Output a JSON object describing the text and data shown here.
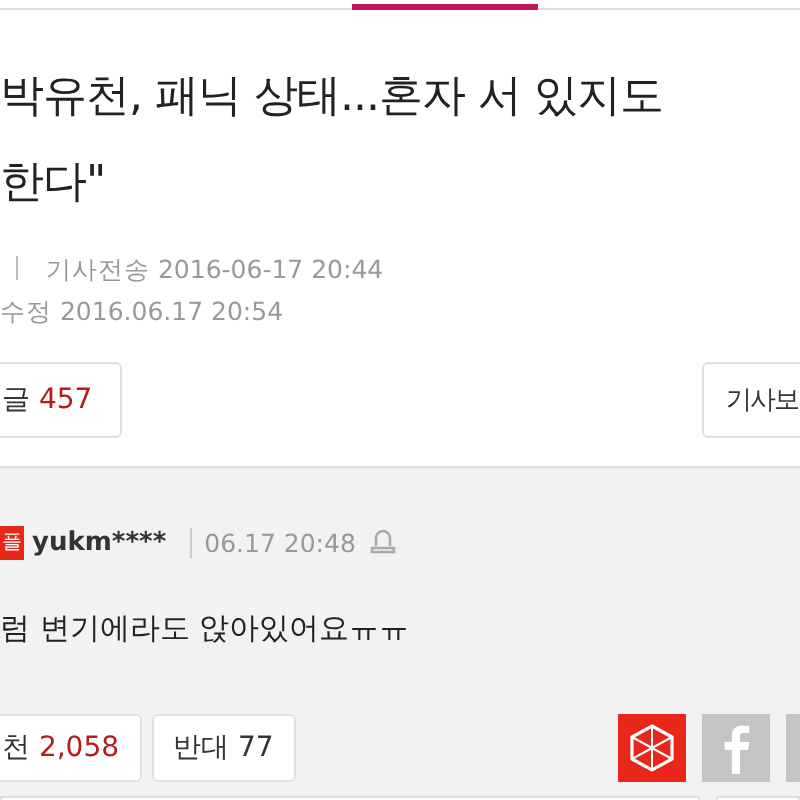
{
  "title_lines": [
    "박유천, 패닉 상태...혼자 서 있지도",
    "한다\""
  ],
  "meta": {
    "sent_label": "기사전송",
    "sent": "2016-06-17 20:44",
    "edited_label": "수정",
    "edited": "2016.06.17 20:54"
  },
  "comment_button": {
    "label": "글",
    "count": "457"
  },
  "article_button": {
    "label": "기사보"
  },
  "comment": {
    "badge": "플",
    "user": "yukm****",
    "time": "06.17 20:48",
    "text": "럼 변기에라도 앉아있어요ㅠㅠ",
    "like": {
      "label": "천",
      "count": "2,058"
    },
    "dislike": {
      "label": "반대",
      "count": "77"
    }
  },
  "share": [
    {
      "kind": "hexagon"
    },
    {
      "kind": "facebook"
    },
    {
      "kind": "plain"
    }
  ]
}
